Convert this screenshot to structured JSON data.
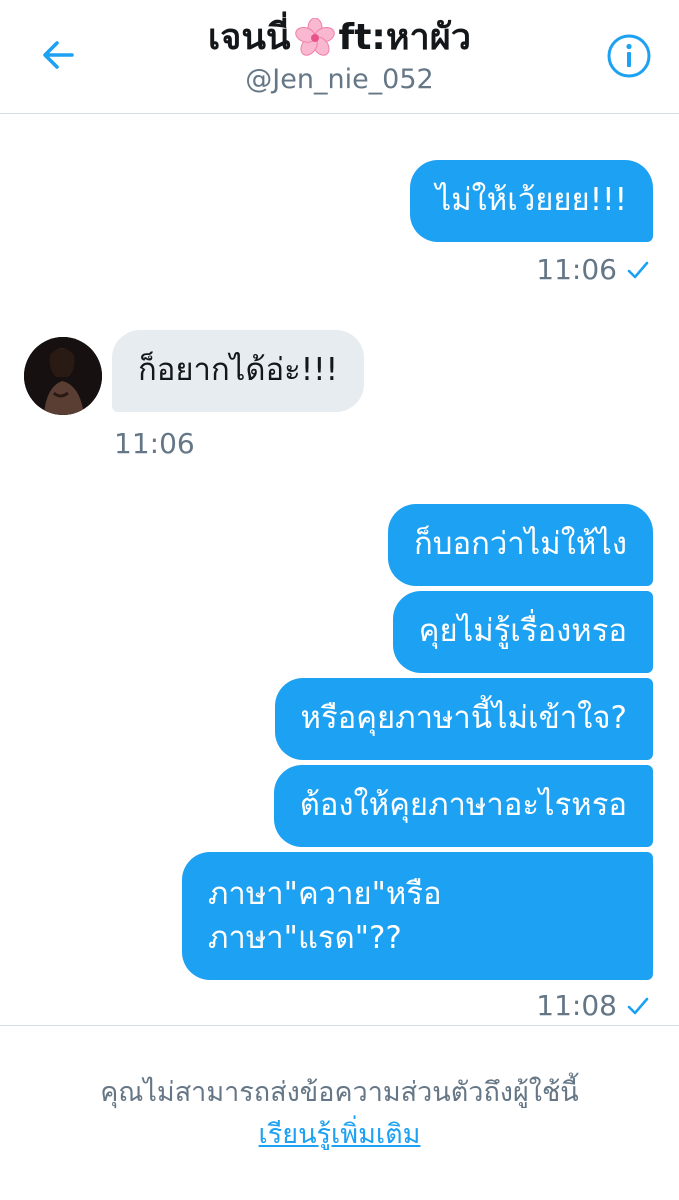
{
  "header": {
    "title_name": "เจนนี่",
    "title_suffix": "ft:หาผัว",
    "handle": "@Jen_nie_052"
  },
  "colors": {
    "accent": "#1da1f2",
    "received_bubble": "#e6ecf0",
    "secondary_text": "#657786"
  },
  "messages": [
    {
      "text": "ไม่ให้เว้ยยย!!!",
      "direction": "sent"
    },
    {
      "text": "11:06",
      "direction": "sent_timestamp"
    },
    {
      "text": "ก็อยากได้อ่ะ!!!",
      "direction": "received"
    },
    {
      "text": "11:06",
      "direction": "received_timestamp"
    },
    {
      "text": "ก็บอกว่าไม่ให้ไง",
      "direction": "sent"
    },
    {
      "text": "คุยไม่รู้เรื่องหรอ",
      "direction": "sent"
    },
    {
      "text": "หรือคุยภาษานี้ไม่เข้าใจ?",
      "direction": "sent"
    },
    {
      "text": "ต้องให้คุยภาษาอะไรหรอ",
      "direction": "sent"
    },
    {
      "text": "ภาษา\"ควาย\"หรือ",
      "direction": "sent"
    },
    {
      "text": "ภาษา\"แรด\"??",
      "direction": "sent"
    },
    {
      "text": "11:08",
      "direction": "sent_timestamp"
    }
  ],
  "footer": {
    "notice": "คุณไม่สามารถส่งข้อความส่วนตัวถึงผู้ใช้นี้",
    "learn_more": "เรียนรู้เพิ่มเติม"
  },
  "icons": [
    "back-arrow-icon",
    "info-icon",
    "cherry-blossom-icon",
    "checkmark-icon"
  ]
}
